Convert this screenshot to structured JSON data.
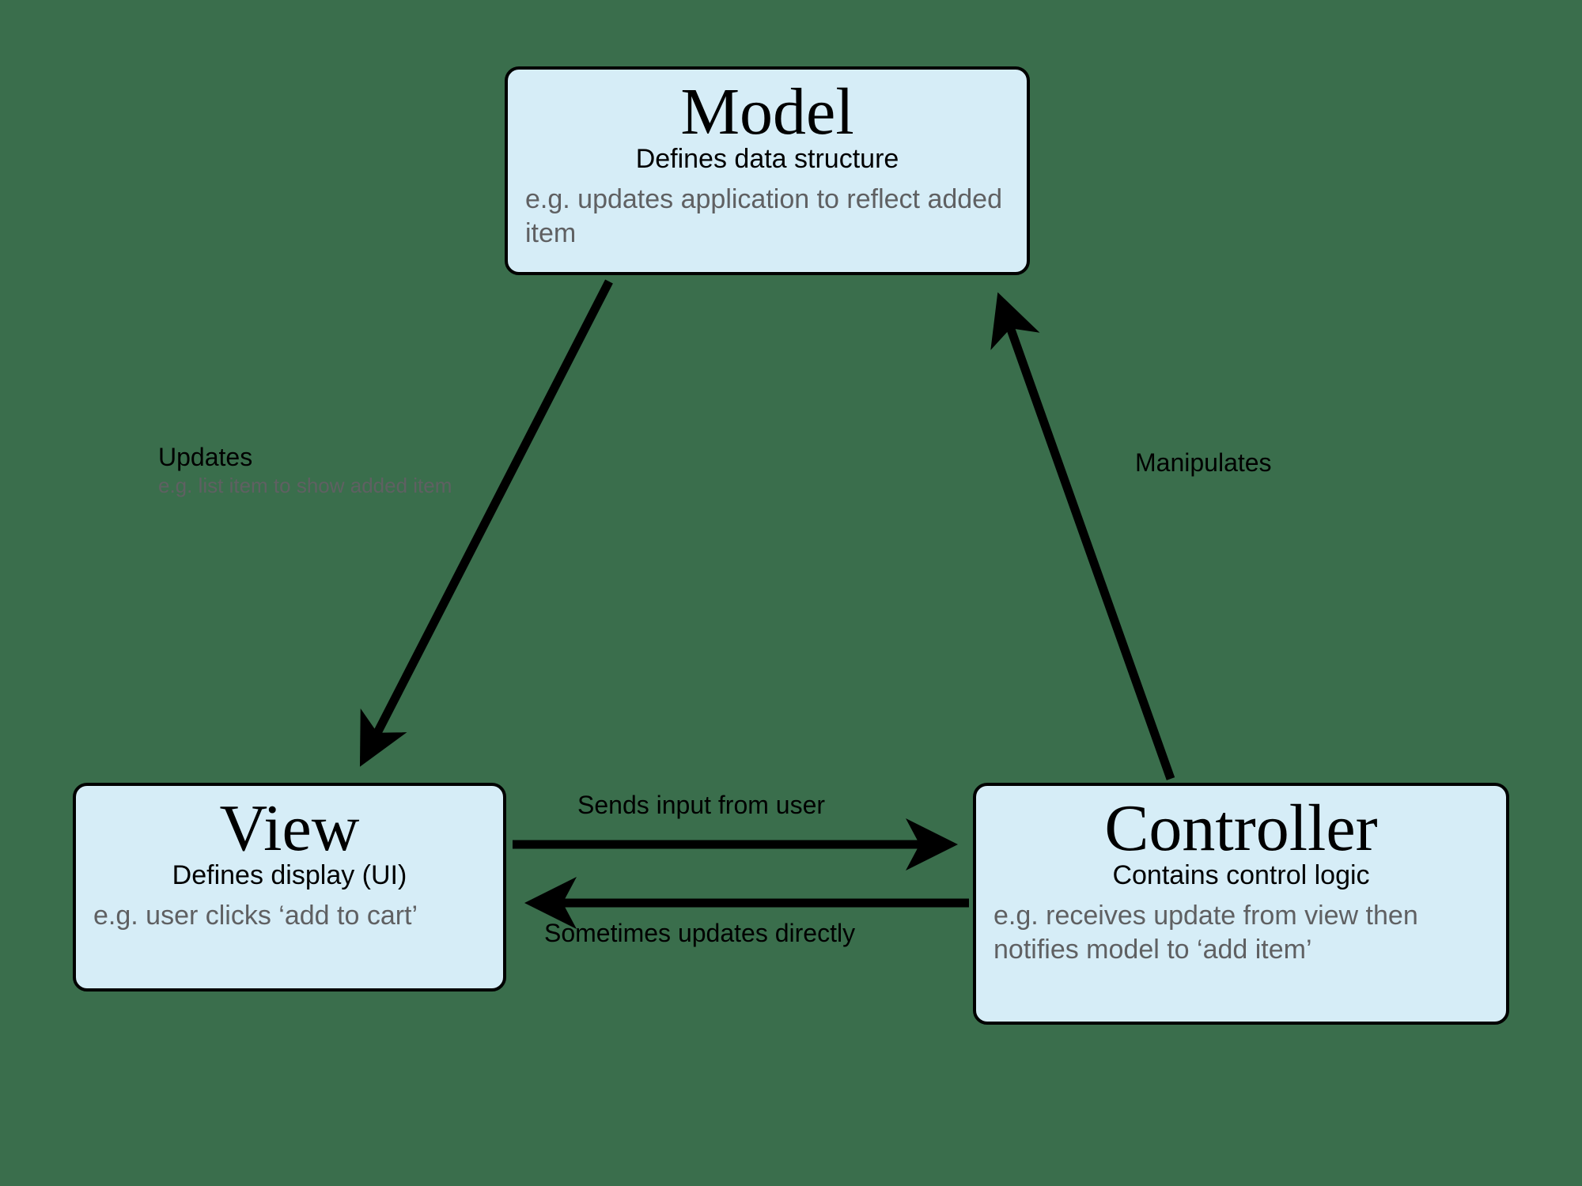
{
  "nodes": {
    "model": {
      "title": "Model",
      "subtitle": "Defines data structure",
      "example": "e.g. updates application to reflect added item"
    },
    "view": {
      "title": "View",
      "subtitle": "Defines display (UI)",
      "example": "e.g. user clicks ‘add to cart’"
    },
    "controller": {
      "title": "Controller",
      "subtitle": "Contains control logic",
      "example": "e.g. receives update from view then notifies model to ‘add item’"
    }
  },
  "edges": {
    "model_to_view": {
      "primary": "Updates",
      "secondary": "e.g. list item to show added item"
    },
    "controller_to_model": {
      "primary": "Manipulates"
    },
    "view_to_controller": {
      "primary": "Sends input from user"
    },
    "controller_to_view": {
      "primary": "Sometimes updates directly"
    }
  }
}
